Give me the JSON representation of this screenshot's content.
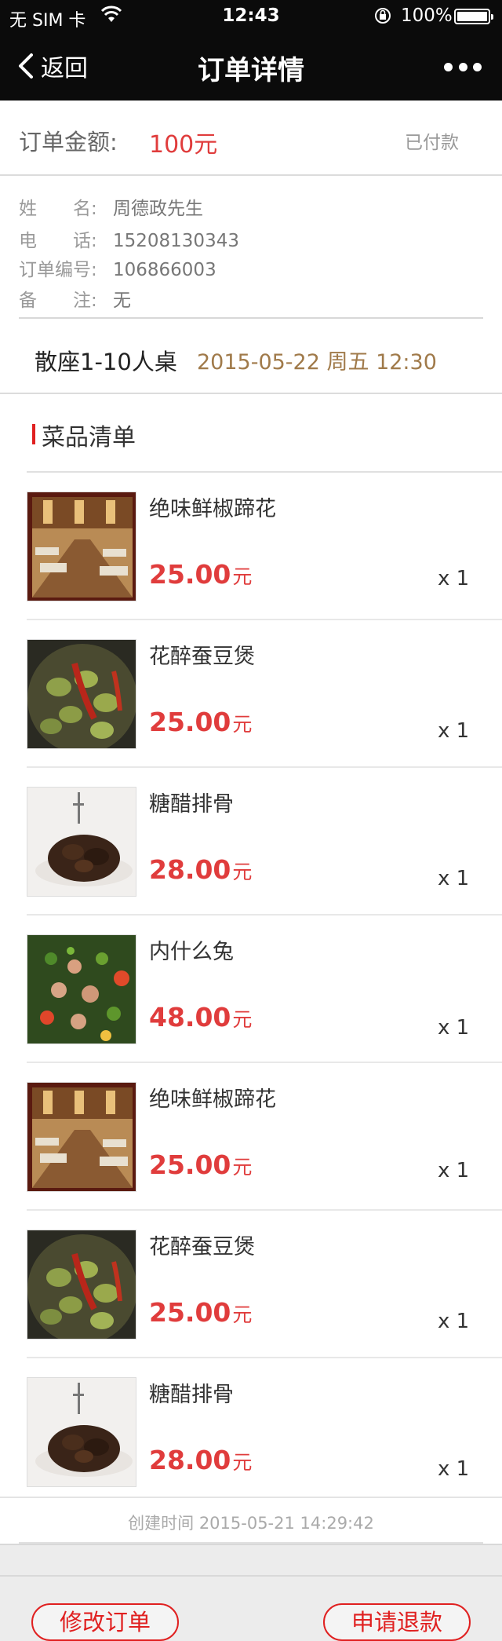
{
  "status_bar": {
    "carrier": "无 SIM 卡",
    "time": "12:43",
    "battery": "100%"
  },
  "nav": {
    "back_label": "返回",
    "title": "订单详情"
  },
  "order": {
    "amount_label": "订单金额:",
    "amount_value": "100元",
    "payment_status": "已付款"
  },
  "customer": [
    {
      "key": "姓　　名:",
      "value": "周德政先生"
    },
    {
      "key": "电　　话:",
      "value": "15208130343"
    },
    {
      "key": "订单编号:",
      "value": "106866003"
    },
    {
      "key": "备　　注:",
      "value": "无"
    }
  ],
  "reservation": {
    "table": "散座1-10人桌",
    "datetime": "2015-05-22 周五 12:30"
  },
  "dishes": {
    "title": "菜品清单",
    "items": [
      {
        "name": "绝味鲜椒蹄花",
        "price": "25.00",
        "unit": "元",
        "qty": "x 1",
        "image": "restaurant-interior"
      },
      {
        "name": "花醉蚕豆煲",
        "price": "25.00",
        "unit": "元",
        "qty": "x 1",
        "image": "broad-beans"
      },
      {
        "name": "糖醋排骨",
        "price": "28.00",
        "unit": "元",
        "qty": "x 1",
        "image": "sweet-sour-ribs"
      },
      {
        "name": "内什么兔",
        "price": "48.00",
        "unit": "元",
        "qty": "x 1",
        "image": "rabbit-peppers"
      },
      {
        "name": "绝味鲜椒蹄花",
        "price": "25.00",
        "unit": "元",
        "qty": "x 1",
        "image": "restaurant-interior"
      },
      {
        "name": "花醉蚕豆煲",
        "price": "25.00",
        "unit": "元",
        "qty": "x 1",
        "image": "broad-beans"
      },
      {
        "name": "糖醋排骨",
        "price": "28.00",
        "unit": "元",
        "qty": "x 1",
        "image": "sweet-sour-ribs"
      }
    ]
  },
  "created_time": "创建时间 2015-05-21 14:29:42",
  "actions": {
    "modify": "修改订单",
    "refund": "申请退款"
  },
  "colors": {
    "accent_red": "#e03c3c",
    "date_brown": "#a07a4a",
    "topbar": "#0b0b0b"
  }
}
